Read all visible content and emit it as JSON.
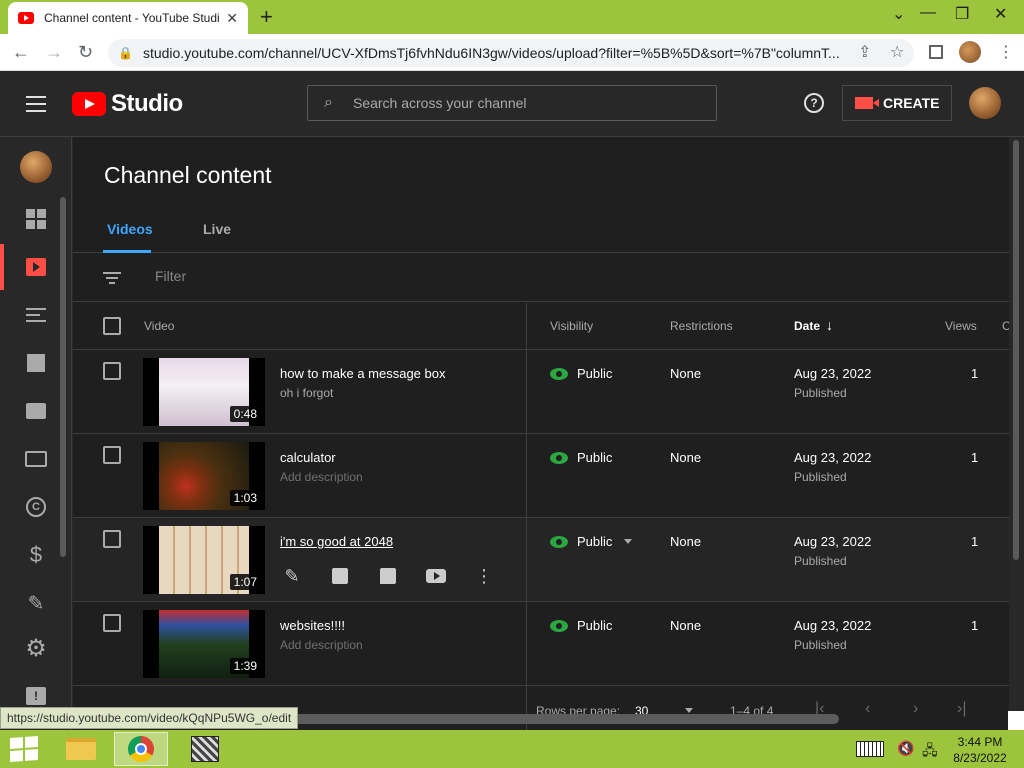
{
  "browser": {
    "tab_title": "Channel content - YouTube Studio",
    "tab_close": "✕",
    "new_tab": "+",
    "url": "studio.youtube.com/channel/UCV-XfDmsTj6fvhNdu6IN3gw/videos/upload?filter=%5B%5D&sort=%7B\"columnT...",
    "status_url": "https://studio.youtube.com/video/kQqNPu5WG_o/edit",
    "back": "←",
    "forward": "→",
    "reload": "↻",
    "lock": "🔒",
    "share": "⇪",
    "bookmark": "☆",
    "menu": "⋮",
    "win_minimize": "⌄",
    "win_min": "—",
    "win_restore": "❐",
    "win_close": "✕"
  },
  "header": {
    "logo_text": "Studio",
    "search_placeholder": "Search across your channel",
    "search_icon": "⌕",
    "help": "?",
    "create_label": "CREATE"
  },
  "sidebar": {
    "items": [
      {
        "icon": "dashboard-icon"
      },
      {
        "icon": "content-icon",
        "active": true
      },
      {
        "icon": "playlists-icon"
      },
      {
        "icon": "analytics-icon"
      },
      {
        "icon": "comments-icon"
      },
      {
        "icon": "subtitles-icon"
      },
      {
        "icon": "copyright-icon",
        "glyph": "C"
      },
      {
        "icon": "monetization-icon",
        "glyph": "$"
      },
      {
        "icon": "customization-icon",
        "glyph": "✎"
      },
      {
        "icon": "settings-icon",
        "glyph": "⚙"
      },
      {
        "icon": "feedback-icon",
        "glyph": "!"
      }
    ]
  },
  "main": {
    "title": "Channel content",
    "tabs": [
      {
        "label": "Videos",
        "active": true
      },
      {
        "label": "Live",
        "active": false
      }
    ],
    "filter_placeholder": "Filter",
    "columns": {
      "video": "Video",
      "visibility": "Visibility",
      "restrictions": "Restrictions",
      "date": "Date",
      "date_sort": "↓",
      "views": "Views",
      "comments": "C"
    },
    "rows": [
      {
        "title": "how to make a message box",
        "description": "oh i forgot",
        "duration": "0:48",
        "visibility": "Public",
        "restrictions": "None",
        "date": "Aug 23, 2022",
        "date_status": "Published",
        "views": "1"
      },
      {
        "title": "calculator",
        "description": "Add description",
        "duration": "1:03",
        "visibility": "Public",
        "restrictions": "None",
        "date": "Aug 23, 2022",
        "date_status": "Published",
        "views": "1"
      },
      {
        "title": "i'm so good at 2048",
        "description": "",
        "duration": "1:07",
        "visibility": "Public",
        "restrictions": "None",
        "date": "Aug 23, 2022",
        "date_status": "Published",
        "views": "1"
      },
      {
        "title": "websites!!!!",
        "description": "Add description",
        "duration": "1:39",
        "visibility": "Public",
        "restrictions": "None",
        "date": "Aug 23, 2022",
        "date_status": "Published",
        "views": "1"
      }
    ],
    "row_actions": {
      "edit": "✎",
      "more": "⋮"
    },
    "pager": {
      "rows_label": "Rows per page:",
      "rows_value": "30",
      "range": "1–4 of 4",
      "first": "|‹",
      "prev": "‹",
      "next": "›",
      "last": "›|"
    }
  },
  "taskbar": {
    "clock_time": "3:44 PM",
    "clock_date": "8/23/2022",
    "volume": "🔇",
    "network": "🖧"
  },
  "colors": {
    "accent_red": "#ff0000",
    "link_blue": "#3ea6ff",
    "public_green": "#2ba640",
    "taskbar_green": "#9cc43c"
  }
}
